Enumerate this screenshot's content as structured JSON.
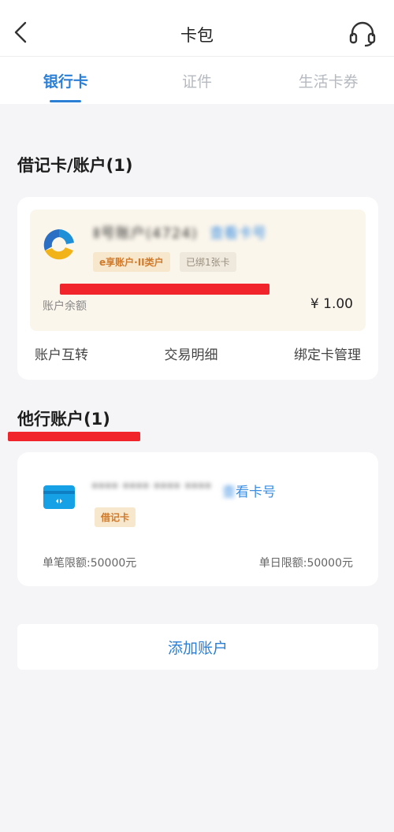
{
  "header": {
    "title": "卡包",
    "back_icon": "chevron-left-icon",
    "service_icon": "headset-icon"
  },
  "tabs": [
    {
      "label": "银行卡",
      "active": true
    },
    {
      "label": "证件",
      "active": false
    },
    {
      "label": "生活卡券",
      "active": false
    }
  ],
  "debit_section": {
    "title": "借记卡/账户(1)",
    "card": {
      "account_name": "Ⅱ号账户(4724)",
      "view_number_link": "查看卡号",
      "tags": [
        "e享账户·II类户",
        "已绑1张卡"
      ],
      "balance_label": "账户余额",
      "balance_value": "¥ 1.00",
      "actions": [
        "账户互转",
        "交易明细",
        "绑定卡管理"
      ]
    }
  },
  "other_section": {
    "title": "他行账户(1)",
    "card": {
      "card_number": "**** **** **** ****",
      "view_number_prefix": "查",
      "view_number_suffix": "看卡号",
      "tag": "借记卡",
      "single_limit": "单笔限额:50000元",
      "daily_limit": "单日限额:50000元"
    }
  },
  "add_account_label": "添加账户",
  "colors": {
    "accent": "#2b80d6",
    "annotation_red": "#f0242a",
    "card_bg": "#fbf6ec"
  }
}
